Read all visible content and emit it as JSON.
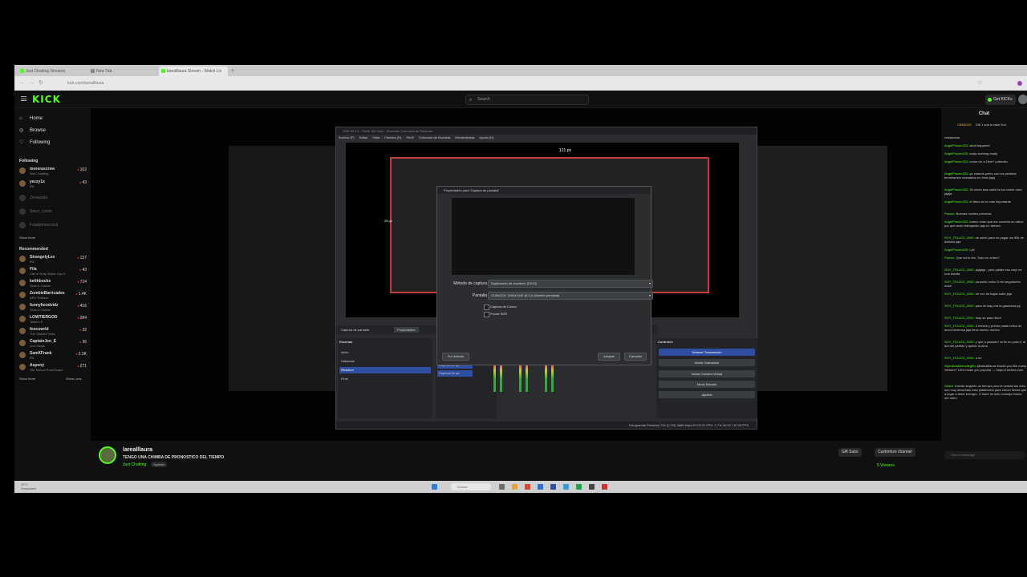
{
  "browser": {
    "tabs": [
      {
        "label": "Just Chatting Streams"
      },
      {
        "label": "New Tab"
      },
      {
        "label": "larealllaura Stream - Watch Liv"
      }
    ],
    "url": "kick.com/larealllaura"
  },
  "kick": {
    "search_placeholder": "Search",
    "get_kicks": "Get KICKs",
    "nav": [
      {
        "label": "Home",
        "icon": "home-icon"
      },
      {
        "label": "Browse",
        "icon": "compass-icon"
      },
      {
        "label": "Following",
        "icon": "heart-icon"
      }
    ],
    "following_title": "Following",
    "following": [
      {
        "name": "moreraxcrew",
        "game": "Just Chatting",
        "viewers": "102"
      },
      {
        "name": "yezzy1x",
        "game": "IRL",
        "viewers": "43"
      },
      {
        "name": "Zerowqda",
        "game": "",
        "viewers": ""
      },
      {
        "name": "Sinon_Lindo",
        "game": "",
        "viewers": ""
      },
      {
        "name": "Falakinmacrocd",
        "game": "",
        "viewers": ""
      }
    ],
    "show_more": "Show More",
    "recommended_title": "Recommended",
    "recommended": [
      {
        "name": "StrangelyLex",
        "game": "IRL",
        "viewers": "137"
      },
      {
        "name": "Fila",
        "game": "Call of Duty: Black Ops 6",
        "viewers": "43"
      },
      {
        "name": "keithbocks",
        "game": "Slots & Casino",
        "viewers": "724"
      },
      {
        "name": "ZombieBarricades",
        "game": "ARC Raiders",
        "viewers": "1.4K"
      },
      {
        "name": "funnyhoodvidz",
        "game": "Slots & Casino",
        "viewers": "416"
      },
      {
        "name": "LOWTIERGOD",
        "game": "Tekken 8",
        "viewers": "284"
      },
      {
        "name": "foxcowrld",
        "game": "The Outlast Trials",
        "viewers": "32"
      },
      {
        "name": "CaptainJen_E",
        "game": "Live Music",
        "viewers": "36"
      },
      {
        "name": "SamXFrank",
        "game": "IRL",
        "viewers": "2.3K"
      },
      {
        "name": "Aspeny",
        "game": "Old School RuneScape",
        "viewers": "271"
      }
    ],
    "show_more2": "Show More",
    "show_less": "Show Less"
  },
  "obs": {
    "title": "OBS 32.0.1 - Perfil: Sin título - Escenas: Colección de Escenas",
    "menu": [
      "Archivo (F)",
      "Editar",
      "Vista",
      "Paneles (D)",
      "Perfil",
      "Colección de Escenas",
      "Herramientas",
      "Ayuda (H)"
    ],
    "measure_top": "121 px",
    "measure_left": "28 px",
    "props": {
      "title": "Propiedades para 'Captura de pantalla'",
      "method_label": "Método de captura",
      "method_value": "Duplicación de escritorio (DXGI)",
      "screen_label": "Pantalla",
      "screen_value": "CU34G2X: 3440x1440 @ 0,0 (Monitor principal)",
      "cursor_label": "Captura de Cursor",
      "sdr_label": "Forzar SDR",
      "defaults": "Por defecto",
      "accept": "Aceptar",
      "cancel": "Cancelar"
    },
    "source_bar": {
      "source": "Captura de pantalla",
      "properties": "Propiedades"
    },
    "scenes_title": "Escenas",
    "scenes": [
      "Inicio",
      "Hablando",
      "Reaction",
      "Final"
    ],
    "active_scene": "Reaction",
    "sources": [
      "Captura de pa",
      "Captura de pa"
    ],
    "controls_title": "Controles",
    "controls": [
      "Detener Transmisión",
      "Iniciar Grabación",
      "Iniciar Cámara Virtual",
      "Modo Estudio",
      "Ajustes"
    ],
    "status": "Fotogramas Perdidos 734 (2.2%)    4668 kbps    00:13:15    CPU: 1.7%    30.00 / 30.00 FPS"
  },
  "stream": {
    "channel": "larealllaura",
    "title": "TENGO UNA CHIMBA DE PRONOSTICO DEL TIEMPO",
    "category": "Just Chatting",
    "language": "Spanish",
    "gift_subs": "Gift Subs",
    "customize": "Customize channel",
    "viewers": "5 Viewers"
  },
  "chat": {
    "title": "Chat",
    "pinned_user": "CBMDOS",
    "pinned_text": "Gift 1 sub to take 2nd",
    "messages": [
      {
        "user": "",
        "text": "resistencia"
      },
      {
        "user": "AngelPinzon333:",
        "text": "what happend"
      },
      {
        "user": "AngelPinzon333:",
        "text": "ando working ready"
      },
      {
        "user": "AngelPinzon333:",
        "text": "cómo vio a Dine? potrecito"
      },
      {
        "user": "AngelPinzon333:",
        "text": "yo cuando peleo con los pelados terminamos mamados en 3min jajaj"
      },
      {
        "user": "AngelPinzon333:",
        "text": "Si! obvio esa vaidrí la los volver nerd jajaja"
      },
      {
        "user": "AngelPinzon333:",
        "text": "el fisico es lo más importante"
      },
      {
        "user": "Parcex:",
        "text": "Buenas noches princesa"
      },
      {
        "user": "AngelPinzon333:",
        "text": "bueno chao que me conecta un ratico por qué ando trabajando jaja un abrazo"
      },
      {
        "user": "SOY_TELLEZ_2000:",
        "text": "se subió para no pagar los 50k de dólares jaja"
      },
      {
        "user": "AngelPinzon333:",
        "text": "Lyfl"
      },
      {
        "user": "Parcex:",
        "text": "Que tal tu día, Todo en orden?"
      },
      {
        "user": "SOY_TELLEZ_2000:",
        "text": "jajajaja , pero paitas esa viejo es una bolsita"
      },
      {
        "user": "SOY_TELLEZ_2000:",
        "text": "ya subió como 5 mil seguidores nosa"
      },
      {
        "user": "SOY_TELLEZ_2000:",
        "text": "en vez de bajas sube jaja"
      },
      {
        "user": "SOY_TELLEZ_2000:",
        "text": "para mi way era la ganadora jaj"
      },
      {
        "user": "SOY_TELLEZ_2000:",
        "text": "may se paso Boof"
      },
      {
        "user": "SOY_TELLEZ_2000:",
        "text": "3 meses y primer paias relica mi amor hermosa jaja lleva mucho mucho"
      },
      {
        "user": "SOY_TELLEZ_2000:",
        "text": "y que a pasado? al fin no pudo ir al día del partido y quedo la Aina"
      },
      {
        "user": "SOY_TELLEZ_2000:",
        "text": "a no"
      },
      {
        "user": "objectionablecollegfex",
        "text": "@larealllaura Would you like many viewers? Let's make you popular — https://nezhna.com"
      },
      {
        "user": "Xlaeci:",
        "text": "Intenté seguirle un tiempo pero la verdad las lives son muy aburridas esta plataforma para crecer llenas que a jugar a tener energía. O hace es solo consejo bueno me retiro"
      }
    ],
    "input_placeholder": "Send a message"
  },
  "taskbar": {
    "weather_temp": "25°C",
    "weather_desc": "Despejado",
    "search": "Buscar"
  },
  "colors": {
    "kick_green": "#53fc18",
    "obs_blue": "#2f4ea1",
    "live_red": "#e33333"
  }
}
